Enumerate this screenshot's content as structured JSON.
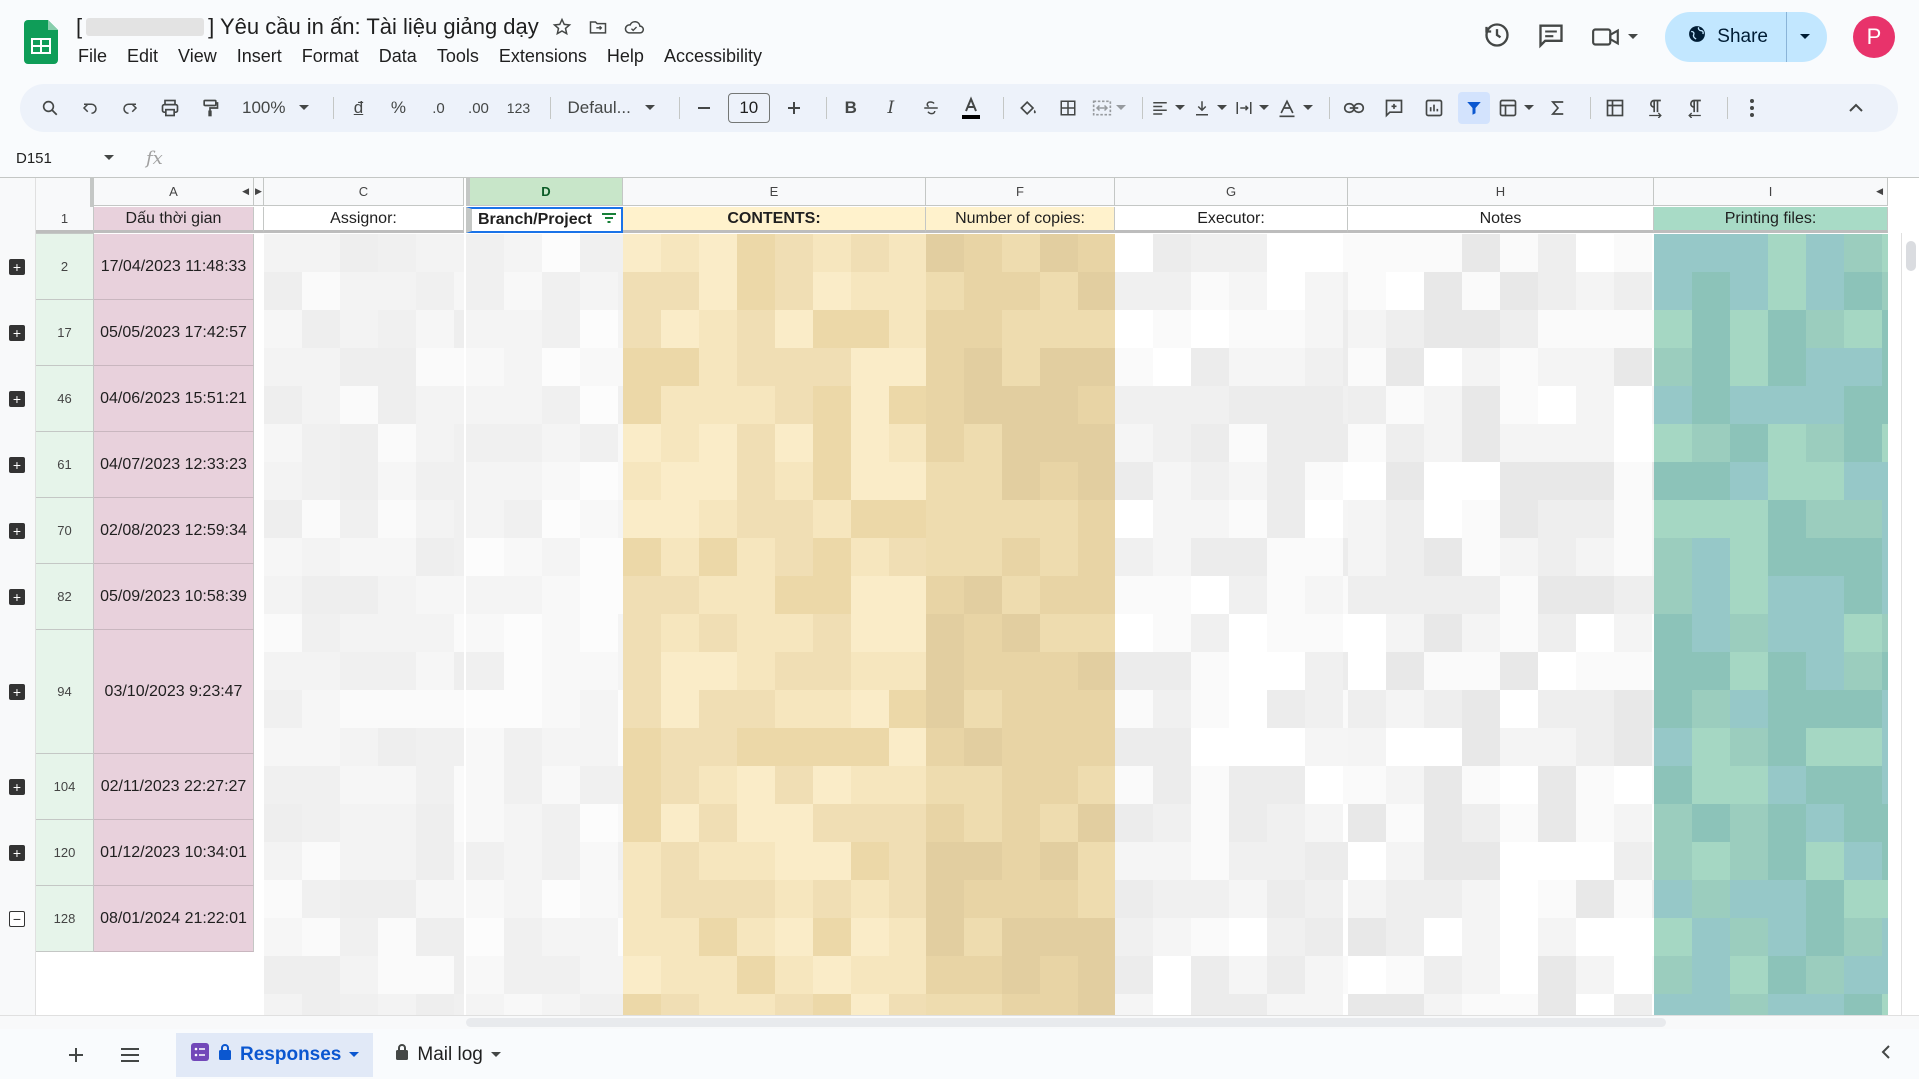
{
  "doc": {
    "title_prefix": "[",
    "title_suffix": "] Yêu cầu in ấn: Tài liệu giảng dạy"
  },
  "menu": [
    "File",
    "Edit",
    "View",
    "Insert",
    "Format",
    "Data",
    "Tools",
    "Extensions",
    "Help",
    "Accessibility"
  ],
  "header_right": {
    "share_label": "Share",
    "avatar_letter": "P"
  },
  "toolbar": {
    "zoom": "100%",
    "currency": "đ",
    "percent": "%",
    "dec_decrease": ".0",
    "dec_increase": ".00",
    "number_format": "123",
    "font": "Defaul...",
    "font_size": "10",
    "bold": "B",
    "italic": "I"
  },
  "formula_bar": {
    "cell_ref": "D151",
    "fx": "fx"
  },
  "columns": [
    "A",
    "C",
    "D",
    "E",
    "F",
    "G",
    "H",
    "I"
  ],
  "header_row": {
    "row_number": "1",
    "cells": [
      "Dấu thời gian",
      "Assignor:",
      "Branch/Project",
      "CONTENTS:",
      "Number of copies:",
      "Executor:",
      "Notes",
      "Printing files:"
    ]
  },
  "rows": [
    {
      "num": "2",
      "date": "17/04/2023 11:48:33"
    },
    {
      "num": "17",
      "date": "05/05/2023 17:42:57"
    },
    {
      "num": "46",
      "date": "04/06/2023 15:51:21"
    },
    {
      "num": "61",
      "date": "04/07/2023 12:33:23"
    },
    {
      "num": "70",
      "date": "02/08/2023 12:59:34"
    },
    {
      "num": "82",
      "date": "05/09/2023 10:58:39"
    },
    {
      "num": "94",
      "date": "03/10/2023 9:23:47"
    },
    {
      "num": "104",
      "date": "02/11/2023 22:27:27"
    },
    {
      "num": "120",
      "date": "01/12/2023 10:34:01"
    },
    {
      "num": "128",
      "date": "08/01/2024 21:22:01"
    }
  ],
  "sheets": {
    "tab1": "Responses",
    "tab2": "Mail log"
  },
  "colors": {
    "accent_green": "#0f9d58",
    "date_col": "#e8d1dc",
    "contents_col": "#fff2cc",
    "printing_col": "#a8dbc6",
    "share_bg": "#c2e7ff",
    "avatar": "#e8336b"
  }
}
